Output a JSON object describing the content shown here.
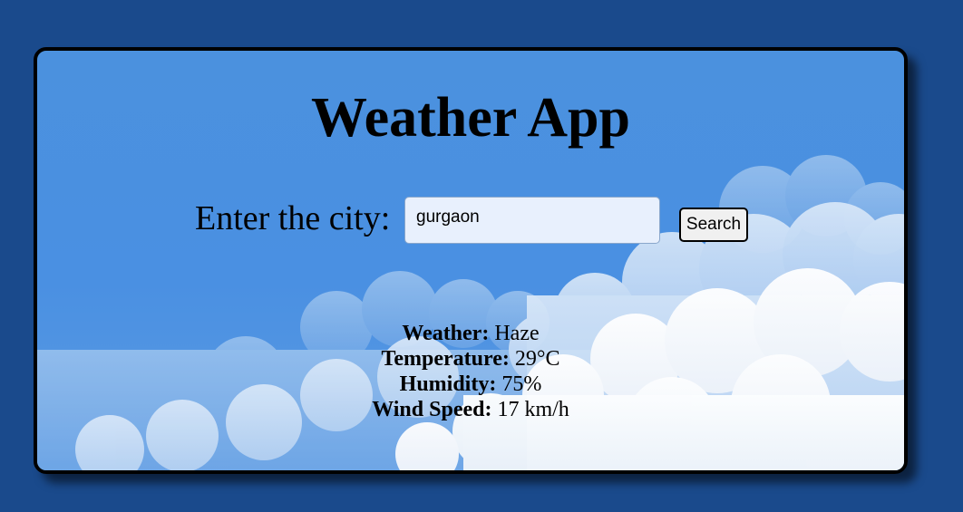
{
  "app": {
    "title": "Weather App"
  },
  "search": {
    "label": "Enter the city:",
    "value": "gurgaon",
    "button_label": "Search"
  },
  "weather": {
    "weather_label": "Weather:",
    "weather_value": "Haze",
    "temperature_label": "Temperature:",
    "temperature_value": "29°C",
    "humidity_label": "Humidity:",
    "humidity_value": "75%",
    "wind_label": "Wind Speed:",
    "wind_value": "17 km/h"
  },
  "colors": {
    "page_background": "#1a4a8c",
    "card_sky": "#4a90e2",
    "cloud": "#ffffff"
  }
}
